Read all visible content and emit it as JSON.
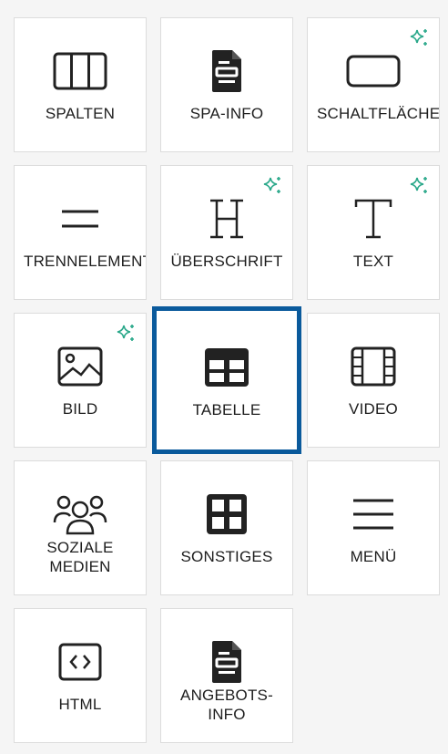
{
  "blocks": [
    {
      "id": "spalten",
      "label": "SPALTEN",
      "icon": "columns-icon",
      "ai": false
    },
    {
      "id": "spa-info",
      "label": "SPA-INFO",
      "icon": "document-icon",
      "ai": false
    },
    {
      "id": "schaltflaeche",
      "label": "SCHALTFLÄCHE",
      "icon": "button-icon",
      "ai": true
    },
    {
      "id": "trennelement",
      "label": "TRENNELEMENT",
      "icon": "divider-icon",
      "ai": false
    },
    {
      "id": "ueberschrift",
      "label": "ÜBERSCHRIFT",
      "icon": "heading-icon",
      "ai": true
    },
    {
      "id": "text",
      "label": "TEXT",
      "icon": "text-icon",
      "ai": true
    },
    {
      "id": "bild",
      "label": "BILD",
      "icon": "image-icon",
      "ai": true
    },
    {
      "id": "tabelle",
      "label": "TABELLE",
      "icon": "table-icon",
      "ai": false,
      "selected": true
    },
    {
      "id": "video",
      "label": "VIDEO",
      "icon": "film-icon",
      "ai": false
    },
    {
      "id": "soziale-medien",
      "label": "SOZIALE MEDIEN",
      "icon": "people-icon",
      "ai": false
    },
    {
      "id": "sonstiges",
      "label": "SONSTIGES",
      "icon": "grid-icon",
      "ai": false
    },
    {
      "id": "menue",
      "label": "MENÜ",
      "icon": "menu-icon",
      "ai": false
    },
    {
      "id": "html",
      "label": "HTML",
      "icon": "code-icon",
      "ai": false
    },
    {
      "id": "angebots-info",
      "label": "ANGEBOTS-INFO",
      "icon": "document-icon",
      "ai": false
    }
  ],
  "colors": {
    "accent": "#0a5a9c",
    "sparkle": "#2aa88a",
    "icon": "#222222"
  }
}
